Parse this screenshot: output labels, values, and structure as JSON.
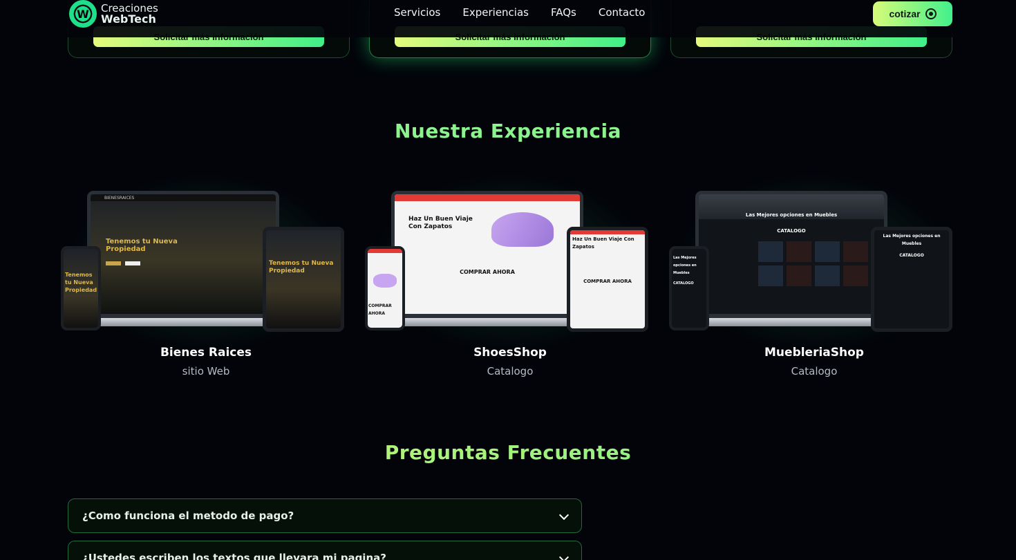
{
  "brand": {
    "line1": "Creaciones",
    "line2": "WebTech"
  },
  "nav": {
    "items": [
      "Servicios",
      "Experiencias",
      "FAQs",
      "Contacto"
    ],
    "cta": "cotizar"
  },
  "pricing_cards": {
    "button_label": "Solicitar más información"
  },
  "experience": {
    "title": "Nuestra Experiencia",
    "items": [
      {
        "name": "Bienes Raices",
        "type": "sitio Web",
        "screen_headline": "Tenemos tu Nueva Propiedad",
        "screen_brand": "BIENESRAICES"
      },
      {
        "name": "ShoesShop",
        "type": "Catalogo",
        "screen_headline": "Haz Un Buen Viaje Con Zapatos",
        "screen_section": "COMPRAR AHORA"
      },
      {
        "name": "MuebleriaShop",
        "type": "Catalogo",
        "screen_headline": "Las Mejores opciones en Muebles",
        "screen_section": "CATALOGO"
      }
    ]
  },
  "faq": {
    "title": "Preguntas Frecuentes",
    "items": [
      {
        "question": "¿Como funciona el metodo de pago?"
      },
      {
        "question": "¿Ustedes escriben los textos que llevara mi pagina?"
      }
    ]
  },
  "colors": {
    "accent_green": "#42f08c",
    "accent_lime": "#d7fb7a",
    "background": "#02040a"
  }
}
